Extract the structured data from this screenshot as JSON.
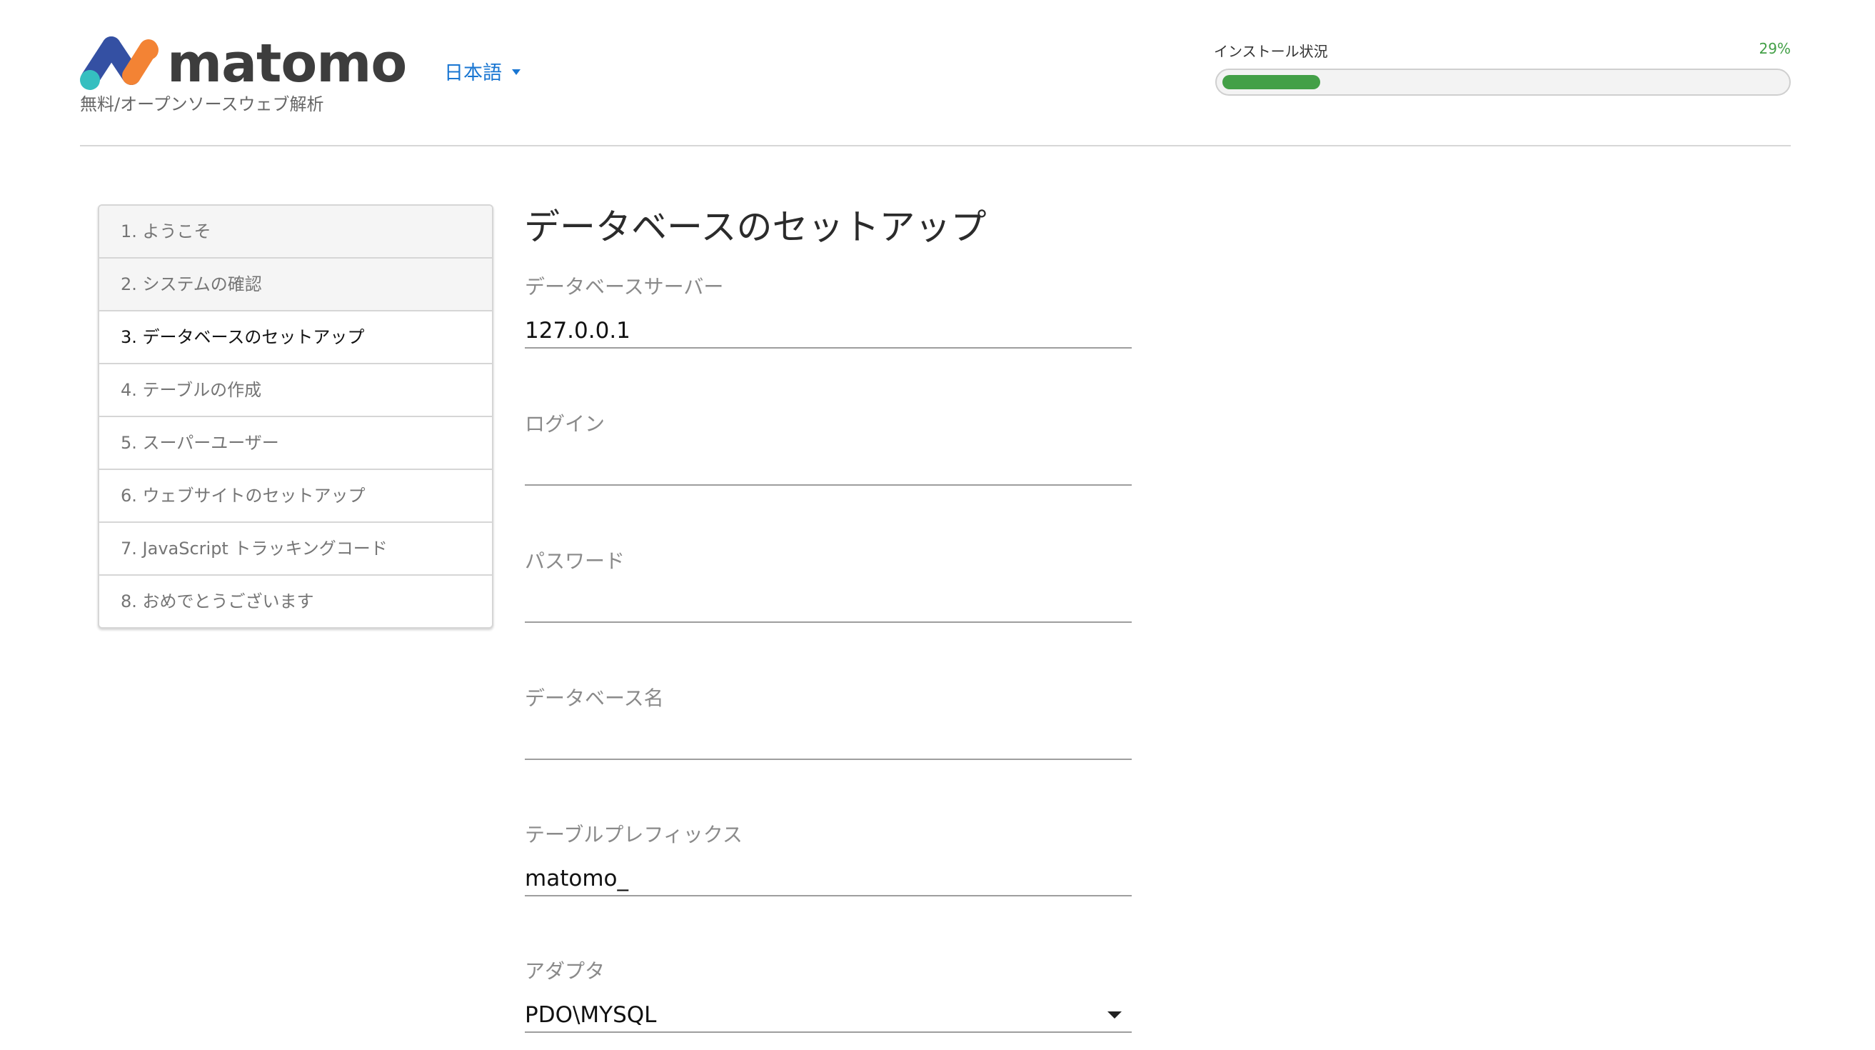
{
  "header": {
    "logo_text": "matomo",
    "tagline": "無料/オープンソースウェブ解析",
    "language": "日本語",
    "progress": {
      "label": "インストール状況",
      "percent_text": "29%",
      "value": 0.29
    }
  },
  "steps": [
    {
      "label": "1. ようこそ",
      "state": "done"
    },
    {
      "label": "2. システムの確認",
      "state": "done"
    },
    {
      "label": "3. データベースのセットアップ",
      "state": "active"
    },
    {
      "label": "4. テーブルの作成",
      "state": "todo"
    },
    {
      "label": "5. スーパーユーザー",
      "state": "todo"
    },
    {
      "label": "6. ウェブサイトのセットアップ",
      "state": "todo"
    },
    {
      "label": "7. JavaScript トラッキングコード",
      "state": "todo"
    },
    {
      "label": "8. おめでとうございます",
      "state": "todo"
    }
  ],
  "form": {
    "title": "データベースのセットアップ",
    "server": {
      "label": "データベースサーバー",
      "value": "127.0.0.1"
    },
    "login": {
      "label": "ログイン",
      "value": ""
    },
    "password": {
      "label": "パスワード",
      "value": ""
    },
    "dbname": {
      "label": "データベース名",
      "value": ""
    },
    "prefix": {
      "label": "テーブルプレフィックス",
      "value": "matomo_"
    },
    "adapter": {
      "label": "アダプタ",
      "value": "PDO\\MYSQL"
    }
  },
  "colors": {
    "accent_blue": "#1976d2",
    "progress_green": "#43a047",
    "logo_blue": "#3450a3",
    "logo_teal": "#35bfc0",
    "logo_orange": "#f38334"
  }
}
